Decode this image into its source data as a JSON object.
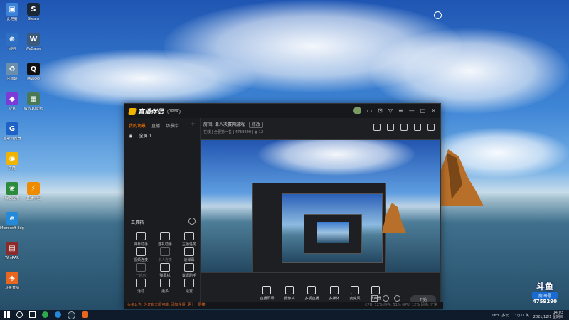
{
  "desktop": {
    "icons": [
      {
        "label": "此电脑",
        "glyph": "▣",
        "color": "#3b82d8"
      },
      {
        "label": "Steam",
        "glyph": "S",
        "color": "#1b2838"
      },
      {
        "label": "网络",
        "glyph": "⊕",
        "color": "#2d6fc2"
      },
      {
        "label": "WeGame",
        "glyph": "W",
        "color": "#3b5a7c"
      },
      {
        "label": "回收站",
        "glyph": "♻",
        "color": "#6a8fae"
      },
      {
        "label": "腾讯QQ",
        "glyph": "Q",
        "color": "#111"
      },
      {
        "label": "夸克",
        "glyph": "◆",
        "color": "#7a3bd8"
      },
      {
        "label": "WIN10壁纸",
        "glyph": "▦",
        "color": "#4a7a55"
      },
      {
        "label": "谷歌浏览器",
        "glyph": "G",
        "color": "#1e62c8"
      },
      {
        "label": "优酷",
        "glyph": "◉",
        "color": "#f0b400"
      },
      {
        "label": "绿色应用",
        "glyph": "❀",
        "color": "#2c8a3e"
      },
      {
        "label": "直播伴侣",
        "glyph": "⚡",
        "color": "#f08a00"
      },
      {
        "label": "Microsoft Edge",
        "glyph": "e",
        "color": "#2489d8"
      },
      {
        "label": "WinRAR",
        "glyph": "▤",
        "color": "#8b2a2a"
      },
      {
        "label": "斗鱼直播",
        "glyph": "◈",
        "color": "#e8661e"
      }
    ]
  },
  "app": {
    "name": "直播伴侣",
    "version": "beta",
    "tabs": [
      "我的场景",
      "直播",
      "场景库"
    ],
    "scene_item": "全屏 1",
    "tools_header": "工具箱",
    "tools": [
      {
        "label": "弹幕助手",
        "dim": false
      },
      {
        "label": "送礼助手",
        "dim": false
      },
      {
        "label": "主播任务",
        "dim": false
      },
      {
        "label": "视频连麦",
        "dim": false
      },
      {
        "label": "多人连麦",
        "dim": true
      },
      {
        "label": "速弹幕",
        "dim": false
      },
      {
        "label": "一起玩",
        "dim": true
      },
      {
        "label": "弹幕机",
        "dim": false
      },
      {
        "label": "数据助手",
        "dim": false
      },
      {
        "label": "活动",
        "dim": false
      },
      {
        "label": "更多",
        "dim": false
      },
      {
        "label": "设置",
        "dim": false
      }
    ],
    "room_label": "房间:",
    "room_title": "单人决赛网游戏",
    "room_tag": "修改",
    "room_info": "在线 | 全服第一名 | 4759290 | ◉ 12",
    "bottom_bar": [
      {
        "label": "直播屏幕"
      },
      {
        "label": "摄像头"
      },
      {
        "label": "多视直播"
      },
      {
        "label": "多媒体"
      },
      {
        "label": "麦克风"
      },
      {
        "label": "扬声器"
      }
    ],
    "start_label": "开始",
    "status_text": "头条公告: 为开启无限可能, 添加伴侣, 更上一层楼",
    "status_right": "CPU: 12%  内存: 51%  GPU: 12%  网络: 正常"
  },
  "taskbar": {
    "weather": "16°C 多云",
    "time": "14:03",
    "date": "2021/12/1 星期三"
  },
  "douyu_badge": {
    "brand": "斗鱼",
    "room_word": "房间号",
    "room_number": "4759290"
  }
}
